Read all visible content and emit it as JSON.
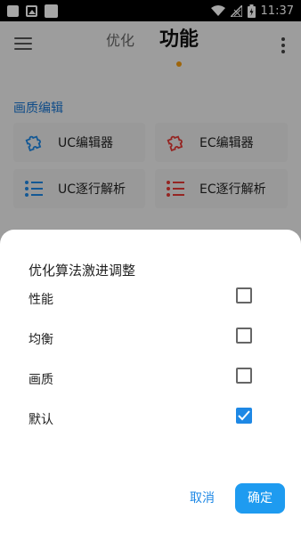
{
  "status_bar": {
    "time": "11:37"
  },
  "app_bar": {
    "tab_optimize": "优化",
    "tab_function": "功能"
  },
  "section": {
    "title": "画质编辑"
  },
  "cards": [
    {
      "label": "UC编辑器",
      "icon": "puzzle-icon",
      "color": "#1e88e5"
    },
    {
      "label": "EC编辑器",
      "icon": "puzzle-icon",
      "color": "#e53935"
    },
    {
      "label": "UC逐行解析",
      "icon": "list-icon",
      "color": "#1e88e5"
    },
    {
      "label": "EC逐行解析",
      "icon": "list-icon",
      "color": "#e53935"
    }
  ],
  "dialog": {
    "title": "优化算法激进调整",
    "options": [
      {
        "label": "性能",
        "checked": false
      },
      {
        "label": "均衡",
        "checked": false
      },
      {
        "label": "画质",
        "checked": false
      },
      {
        "label": "默认",
        "checked": true
      }
    ],
    "cancel_label": "取消",
    "ok_label": "确定"
  },
  "colors": {
    "accent": "#1e88e5",
    "indicator": "#f39c12"
  }
}
